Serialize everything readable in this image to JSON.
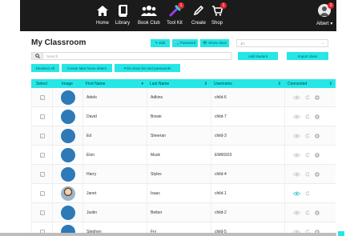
{
  "nav": {
    "items": [
      {
        "label": "Home",
        "icon": "home-icon"
      },
      {
        "label": "Library",
        "icon": "book-icon"
      },
      {
        "label": "Book Club",
        "icon": "group-icon"
      },
      {
        "label": "Tool Kit",
        "icon": "tools-icon",
        "badge": "1"
      },
      {
        "label": "Create",
        "icon": "pencil-icon"
      },
      {
        "label": "Shop",
        "icon": "cart-icon",
        "badge": "1"
      }
    ],
    "user": {
      "label": "Albert ▾",
      "badge": "3"
    }
  },
  "page": {
    "title": "My Classroom"
  },
  "toolbar": {
    "edit_label": "✎ Edit",
    "password_label": "🔍 Password",
    "show_class_label": "👁 Show class",
    "class_select": "JH"
  },
  "search": {
    "placeholder": "Search"
  },
  "actions": {
    "deselect_all": "Deselect All",
    "take_home": "Create take home letters",
    "print": "Print class list and passwords",
    "add_student": "Add student",
    "import_class": "Import class"
  },
  "table": {
    "headers": [
      "Select",
      "Image",
      "First Name",
      "Last Name",
      "Usernams",
      "Connected"
    ],
    "rows": [
      {
        "first": "Adelo",
        "last": "Adkins",
        "user": "child-6",
        "photo": false,
        "connected": false
      },
      {
        "first": "David",
        "last": "Bowie",
        "user": "child-7",
        "photo": false,
        "connected": false
      },
      {
        "first": "Ed",
        "last": "Sheeran",
        "user": "child-3",
        "photo": false,
        "connected": false
      },
      {
        "first": "Elon",
        "last": "Musk",
        "user": "EM66923",
        "photo": false,
        "connected": false
      },
      {
        "first": "Harry",
        "last": "Styles",
        "user": "child-4",
        "photo": false,
        "connected": false
      },
      {
        "first": "Janet",
        "last": "Isaac",
        "user": "child-1",
        "photo": true,
        "connected": true
      },
      {
        "first": "Justin",
        "last": "Beiber",
        "user": "child-2",
        "photo": false,
        "connected": false
      },
      {
        "first": "Stephen",
        "last": "Fry",
        "user": "child-5",
        "photo": false,
        "connected": false
      }
    ]
  },
  "colors": {
    "accent": "#26e6e6",
    "nav_bg": "#1b1b1b",
    "avatar": "#2e79b8",
    "badge": "#e3242b"
  }
}
